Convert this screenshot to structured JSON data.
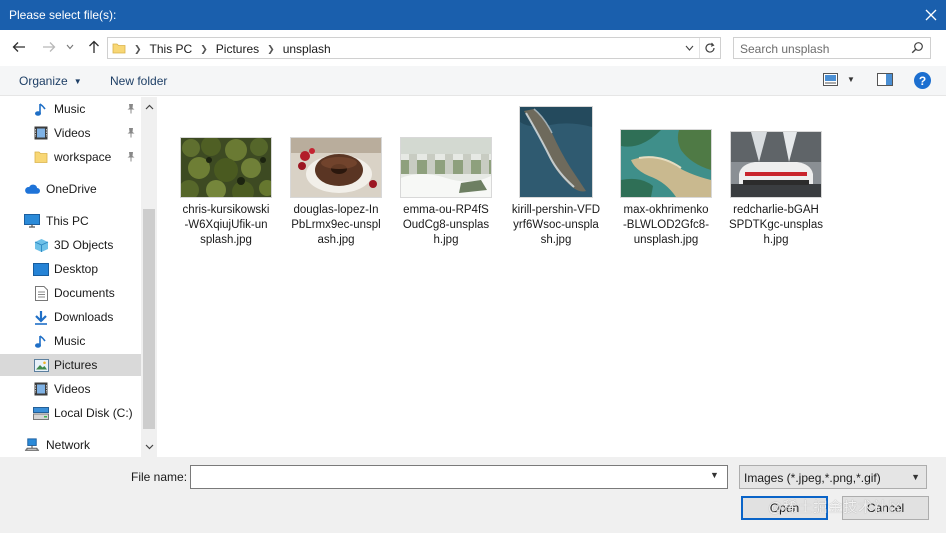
{
  "dialog": {
    "title": "Please select file(s):"
  },
  "address": {
    "crumbs": [
      "This PC",
      "Pictures",
      "unsplash"
    ]
  },
  "search": {
    "placeholder": "Search unsplash"
  },
  "toolbar": {
    "organize_label": "Organize",
    "new_folder_label": "New folder"
  },
  "sidebar": {
    "items": [
      {
        "label": "Music",
        "icon": "music-icon",
        "pinned": true
      },
      {
        "label": "Videos",
        "icon": "videos-icon",
        "pinned": true
      },
      {
        "label": "workspace",
        "icon": "folder-icon",
        "pinned": true
      },
      {
        "label": "OneDrive",
        "icon": "cloud-icon",
        "pinned": false
      },
      {
        "label": "This PC",
        "icon": "computer-icon",
        "pinned": false
      },
      {
        "label": "3D Objects",
        "icon": "cube-icon",
        "pinned": false
      },
      {
        "label": "Desktop",
        "icon": "desktop-icon",
        "pinned": false
      },
      {
        "label": "Documents",
        "icon": "documents-icon",
        "pinned": false
      },
      {
        "label": "Downloads",
        "icon": "download-icon",
        "pinned": false
      },
      {
        "label": "Music",
        "icon": "music-icon",
        "pinned": false
      },
      {
        "label": "Pictures",
        "icon": "pictures-icon",
        "pinned": false,
        "selected": true
      },
      {
        "label": "Videos",
        "icon": "videos-icon",
        "pinned": false
      },
      {
        "label": "Local Disk (C:)",
        "icon": "disk-icon",
        "pinned": false
      },
      {
        "label": "Network",
        "icon": "network-icon",
        "pinned": false
      }
    ]
  },
  "files": [
    {
      "name": "chris-kursikowski-W6XqiujUfik-unsplash.jpg",
      "name_lines": [
        "chris-kursikowski",
        "-W6XqiujUfik-un",
        "splash.jpg"
      ],
      "thumb": "forest aerial"
    },
    {
      "name": "douglas-lopez-InPbLrmx9ec-unsplash.jpg",
      "name_lines": [
        "douglas-lopez-In",
        "PbLrmx9ec-unspl",
        "ash.jpg"
      ],
      "thumb": "bundt cake"
    },
    {
      "name": "emma-ou-RP4fSOudCg8-unsplash.jpg",
      "name_lines": [
        "emma-ou-RP4fS",
        "OudCg8-unsplas",
        "h.jpg"
      ],
      "thumb": "snowy fence"
    },
    {
      "name": "kirill-pershin-VFDyrf6Wsoc-unsplash.jpg",
      "name_lines": [
        "kirill-pershin-VFD",
        "yrf6Wsoc-unspla",
        "sh.jpg"
      ],
      "thumb": "coastline aerial"
    },
    {
      "name": "max-okhrimenko-BLWLOD2Gfc8-unsplash.jpg",
      "name_lines": [
        "max-okhrimenko",
        "-BLWLOD2Gfc8-",
        "unsplash.jpg"
      ],
      "thumb": "river delta aerial"
    },
    {
      "name": "redcharlie-bGAHSPDTKgc-unsplash.jpg",
      "name_lines": [
        "redcharlie-bGAH",
        "SPDTKgc-unsplas",
        "h.jpg"
      ],
      "thumb": "white car"
    }
  ],
  "bottom": {
    "file_name_label": "File name:",
    "file_name_value": "",
    "filter_label": "Images (*.jpeg,*.png,*.gif)",
    "open_label": "Open",
    "cancel_label": "Cancel",
    "watermark": "@稀土掘金技术社区"
  },
  "colors": {
    "titlebar": "#1a5fad",
    "accent": "#0a64c8",
    "selected_bg": "#d9d9d9"
  }
}
